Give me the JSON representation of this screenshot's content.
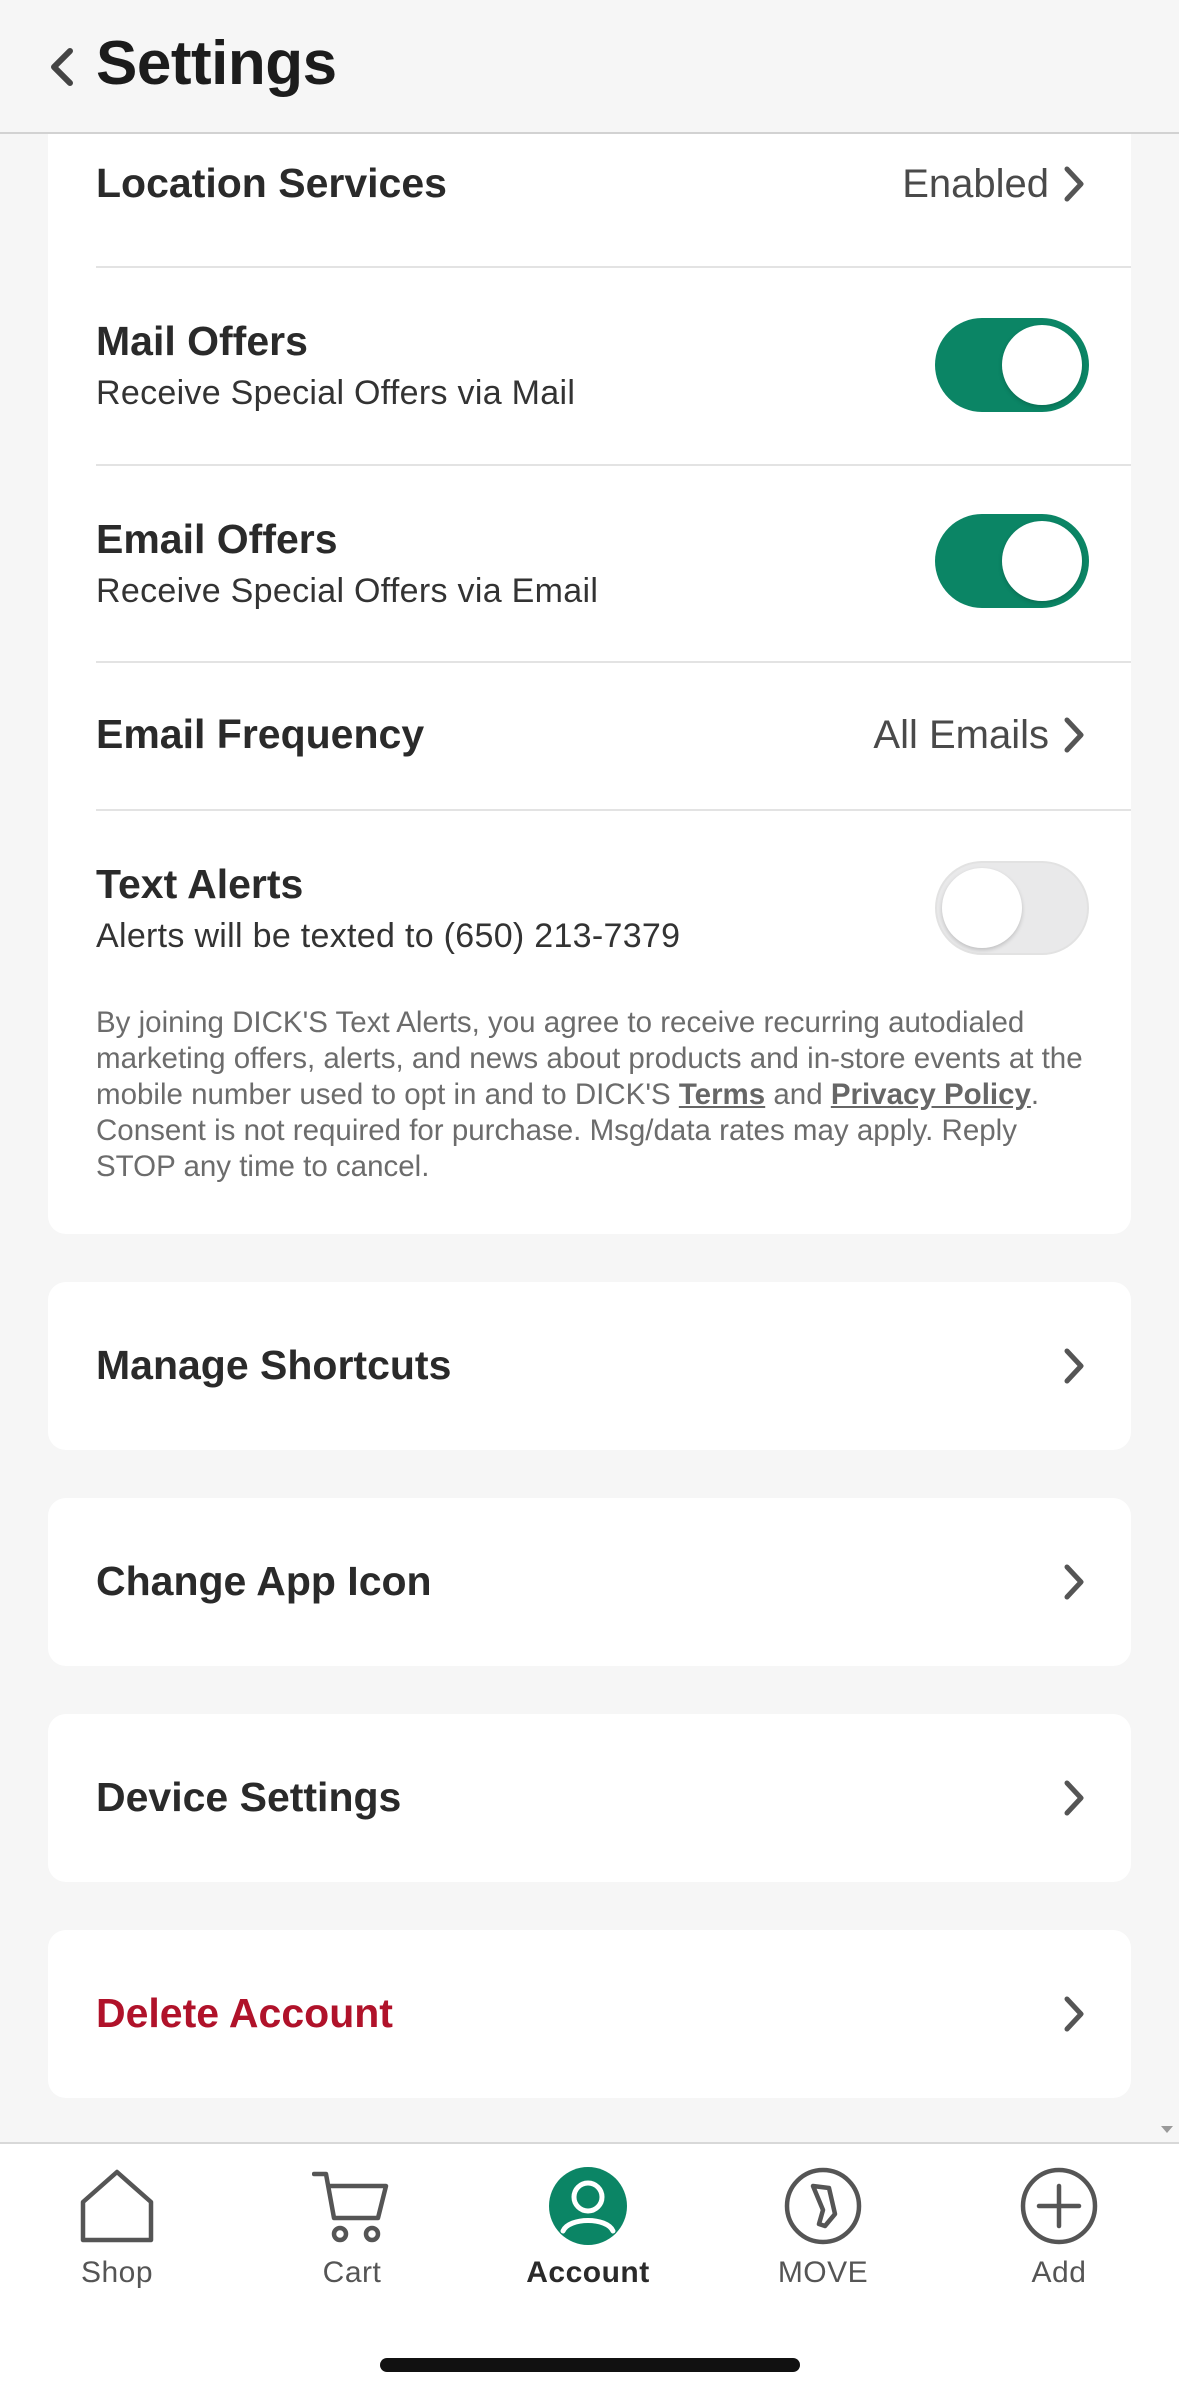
{
  "header": {
    "title": "Settings"
  },
  "settings": {
    "location_services": {
      "label": "Location Services",
      "value": "Enabled"
    },
    "mail_offers": {
      "label": "Mail Offers",
      "sub": "Receive Special Offers via Mail",
      "enabled": true
    },
    "email_offers": {
      "label": "Email Offers",
      "sub": "Receive Special Offers via Email",
      "enabled": true
    },
    "email_frequency": {
      "label": "Email Frequency",
      "value": "All Emails"
    },
    "text_alerts": {
      "label": "Text Alerts",
      "sub": "Alerts will be texted to (650) 213-7379",
      "enabled": false
    },
    "disclaimer": {
      "part1": "By joining DICK'S Text Alerts, you agree to receive recurring autodialed marketing offers, alerts, and news about products and in-store events at the mobile number used to opt in and to DICK'S ",
      "terms": "Terms",
      "and": " and ",
      "privacy": "Privacy Policy",
      "part2": ". Consent is not required for purchase. Msg/data rates may apply. Reply STOP any time to cancel."
    }
  },
  "menu": {
    "manage_shortcuts": "Manage Shortcuts",
    "change_app_icon": "Change App Icon",
    "device_settings": "Device Settings",
    "delete_account": "Delete Account"
  },
  "tabbar": {
    "tabs": [
      {
        "label": "Shop",
        "icon": "home-icon"
      },
      {
        "label": "Cart",
        "icon": "cart-icon"
      },
      {
        "label": "Account",
        "icon": "account-icon",
        "active": true
      },
      {
        "label": "MOVE",
        "icon": "move-icon"
      },
      {
        "label": "Add",
        "icon": "add-icon"
      }
    ]
  },
  "colors": {
    "accent": "#0b8565",
    "danger": "#b0122a"
  }
}
